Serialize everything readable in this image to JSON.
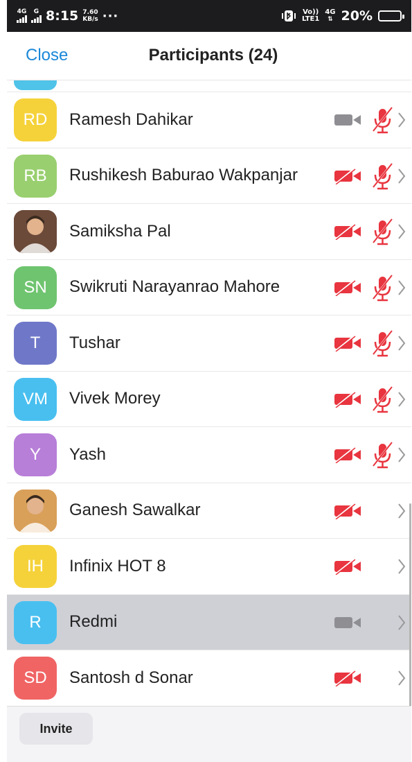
{
  "status_bar": {
    "sim1": "4G",
    "sim2": "G",
    "time": "8:15",
    "net_speed_value": "7.60",
    "net_speed_unit": "KB/s",
    "more": "···",
    "volte_top": "Vo))",
    "volte_bottom": "LTE1",
    "net_4g": "4G",
    "battery": "20%",
    "battery_level": 0.2
  },
  "header": {
    "close_label": "Close",
    "title": "Participants (24)"
  },
  "participants": [
    {
      "initials": "RD",
      "name": "Ramesh Dahikar",
      "color": "#f5d23a",
      "video": "on",
      "audio": "muted"
    },
    {
      "initials": "RB",
      "name": "Rushikesh Baburao Wakpanjar",
      "color": "#99cf6f",
      "video": "off",
      "audio": "muted"
    },
    {
      "initials": "",
      "name": "Samiksha Pal",
      "color": "#6b4a3a",
      "photo": true,
      "video": "off",
      "audio": "muted"
    },
    {
      "initials": "SN",
      "name": "Swikruti Narayanrao Mahore",
      "color": "#6fc46f",
      "video": "off",
      "audio": "muted"
    },
    {
      "initials": "T",
      "name": "Tushar",
      "color": "#6f78c8",
      "video": "off",
      "audio": "muted"
    },
    {
      "initials": "VM",
      "name": "Vivek Morey",
      "color": "#49bff0",
      "video": "off",
      "audio": "muted"
    },
    {
      "initials": "Y",
      "name": "Yash",
      "color": "#b77fd8",
      "video": "off",
      "audio": "muted"
    },
    {
      "initials": "",
      "name": "Ganesh Sawalkar",
      "color": "#d9a05a",
      "photo": true,
      "video": "off",
      "audio": "none"
    },
    {
      "initials": "IH",
      "name": "Infinix HOT 8",
      "color": "#f5d23a",
      "video": "off",
      "audio": "none"
    },
    {
      "initials": "R",
      "name": "Redmi",
      "color": "#49bff0",
      "video": "on",
      "audio": "none",
      "selected": true
    },
    {
      "initials": "SD",
      "name": "Santosh d Sonar",
      "color": "#f06464",
      "video": "off",
      "audio": "none"
    }
  ],
  "colors": {
    "accent": "#1b88d8",
    "muted_red": "#e8353f",
    "icon_gray": "#8e8e93"
  },
  "footer": {
    "invite_label": "Invite"
  }
}
